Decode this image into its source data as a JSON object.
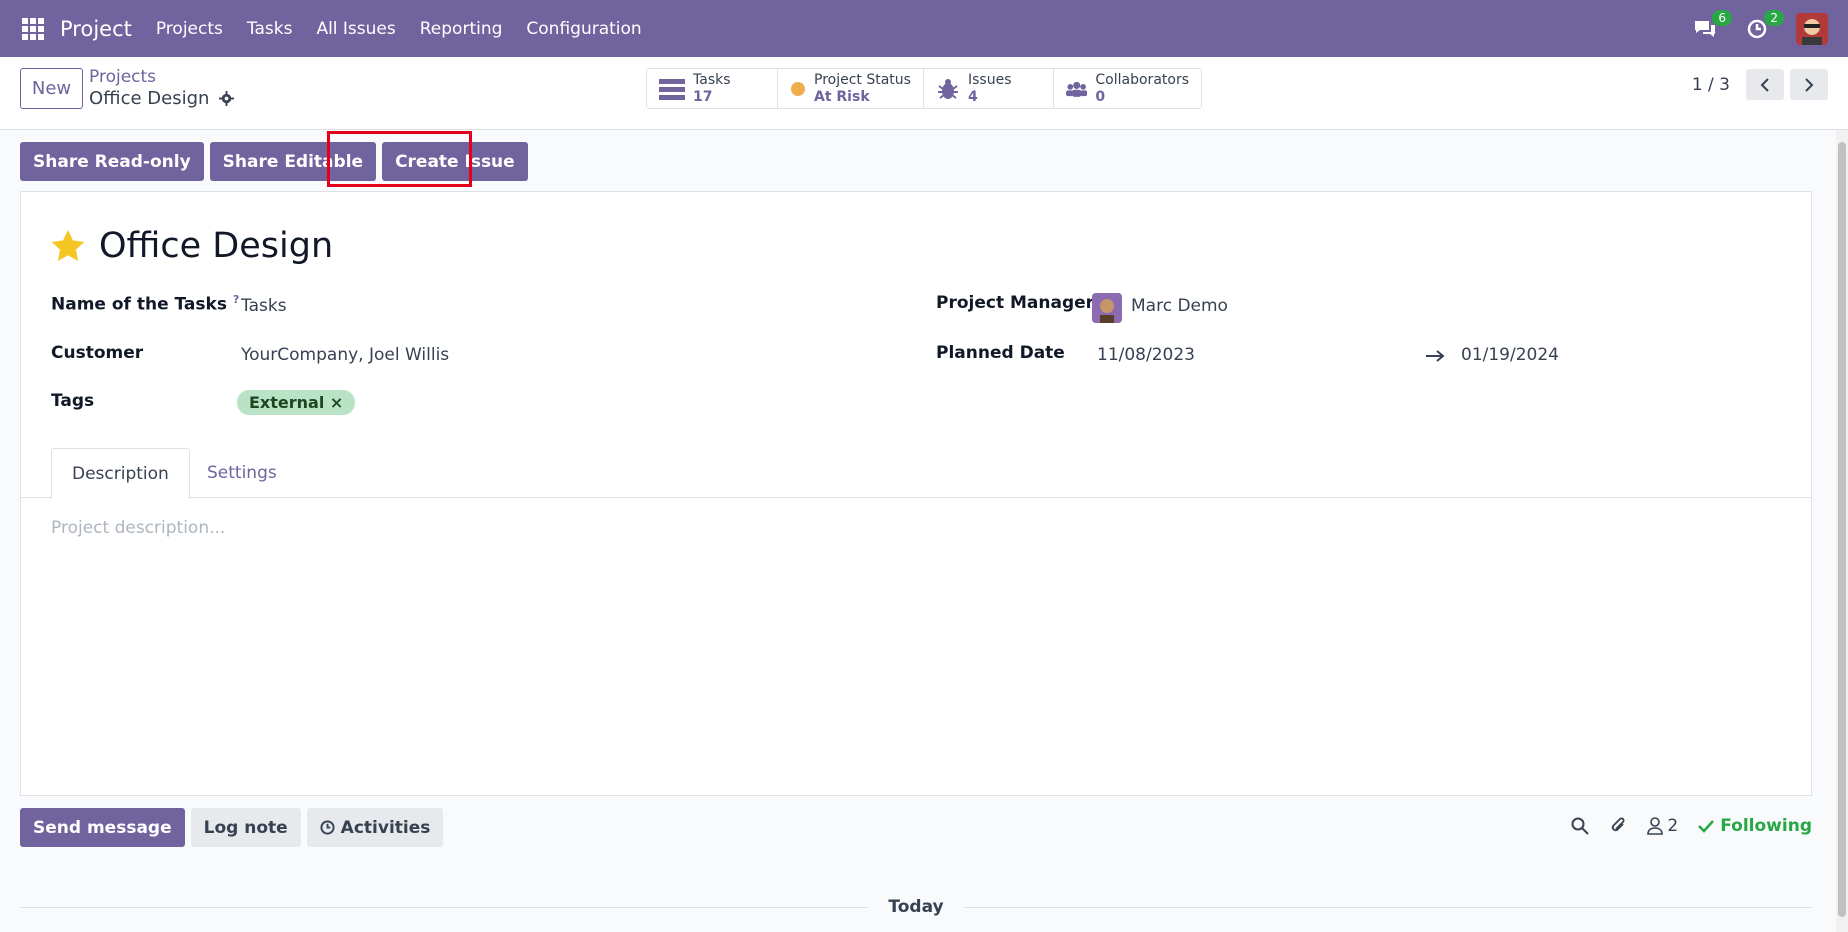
{
  "nav": {
    "app_name": "Project",
    "menu": [
      "Projects",
      "Tasks",
      "All Issues",
      "Reporting",
      "Configuration"
    ],
    "messages_count": "6",
    "activities_count": "2"
  },
  "control": {
    "new_label": "New",
    "breadcrumb_parent": "Projects",
    "breadcrumb_current": "Office Design",
    "stats": [
      {
        "label": "Tasks",
        "value": "17",
        "icon": "tasks-icon"
      },
      {
        "label": "Project Status",
        "value": "At Risk",
        "icon": "status-dot-icon"
      },
      {
        "label": "Issues",
        "value": "4",
        "icon": "bug-icon"
      },
      {
        "label": "Collaborators",
        "value": "0",
        "icon": "users-icon"
      }
    ],
    "pager": "1 / 3"
  },
  "actions": {
    "share_readonly": "Share Read-only",
    "share_editable": "Share Editable",
    "create_issue": "Create Issue"
  },
  "form": {
    "title": "Office Design",
    "name_of_tasks_label": "Name of the Tasks",
    "help_mark": "?",
    "name_of_tasks_value": "Tasks",
    "customer_label": "Customer",
    "customer_value": "YourCompany, Joel Willis",
    "tags_label": "Tags",
    "tag": "External",
    "tag_remove": "×",
    "manager_label": "Project Manager",
    "manager_value": "Marc Demo",
    "planned_label": "Planned Date",
    "date_start": "11/08/2023",
    "date_end": "01/19/2024",
    "tabs": [
      "Description",
      "Settings"
    ],
    "description_placeholder": "Project description..."
  },
  "chatter": {
    "send_message": "Send message",
    "log_note": "Log note",
    "activities": "Activities",
    "followers_count": "2",
    "following": "Following",
    "today": "Today"
  },
  "colors": {
    "brand": "#71639e",
    "status_at_risk": "#f0ad4e",
    "following": "#28a745"
  }
}
